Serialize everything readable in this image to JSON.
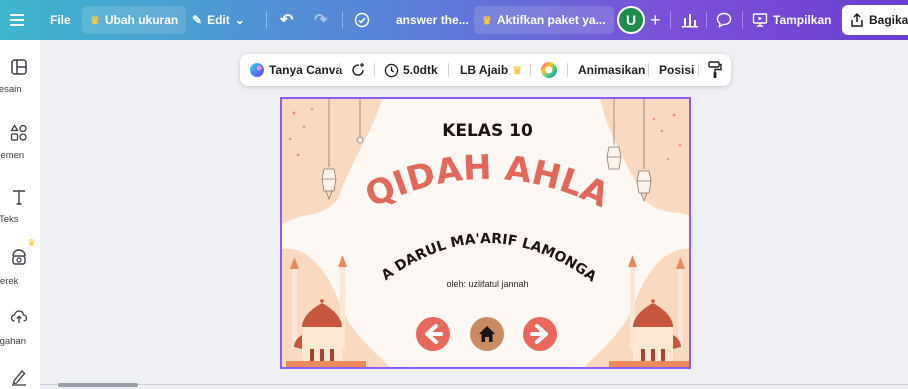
{
  "topbar": {
    "file_label": "File",
    "resize_label": "Ubah ukuran",
    "edit_label": "Edit",
    "doc_title": "answer the...",
    "promo_label": "Aktifkan paket ya...",
    "avatar_letter": "U",
    "present_label": "Tampilkan",
    "share_label": "Bagikan"
  },
  "sidebar": {
    "items": [
      {
        "label": "Desain",
        "icon": "layout-icon"
      },
      {
        "label": "Elemen",
        "icon": "elements-icon"
      },
      {
        "label": "Teks",
        "icon": "text-icon"
      },
      {
        "label": "Merek",
        "icon": "brand-icon"
      },
      {
        "label": "Unggahan",
        "icon": "upload-icon"
      },
      {
        "label": "",
        "icon": "draw-icon"
      }
    ]
  },
  "toolbar": {
    "ask_canva": "Tanya Canva",
    "duration": "5.0dtk",
    "font_name": "LB Ajaib",
    "animate": "Animasikan",
    "position": "Posisi"
  },
  "slide": {
    "kelas": "KELAS 10",
    "main_title": "AQIDAH AHLAK",
    "school": "MA DARUL MA'ARIF LAMONGAN",
    "author": "oleh: uzlifatul jannah"
  },
  "colors": {
    "accent": "#8b5cf6",
    "title_red": "#e2685c",
    "peach": "#f9d9c0",
    "nav_red": "#e8685e",
    "nav_brown": "#c98c62"
  }
}
